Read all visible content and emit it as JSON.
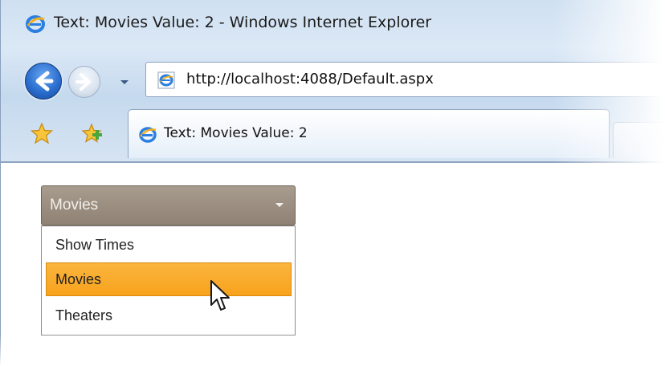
{
  "window": {
    "title": "Text: Movies Value: 2 - Windows Internet Explorer"
  },
  "address_bar": {
    "url": "http://localhost:4088/Default.aspx"
  },
  "tabs": [
    {
      "label": "Text: Movies Value: 2"
    }
  ],
  "combo": {
    "selected_text": "Movies",
    "items": [
      {
        "label": "Show Times"
      },
      {
        "label": "Movies"
      },
      {
        "label": "Theaters"
      }
    ],
    "highlighted_index": 1
  },
  "colors": {
    "combo_bg": "#9a8d7f",
    "highlight": "#f9ab2b",
    "chrome": "#d6e4f3"
  },
  "icons": {
    "ie": "ie-logo-icon",
    "back": "back-arrow-icon",
    "forward": "forward-arrow-icon",
    "favorites": "favorites-star-icon",
    "add_favorites": "add-favorites-icon",
    "cursor": "mouse-pointer-icon"
  }
}
